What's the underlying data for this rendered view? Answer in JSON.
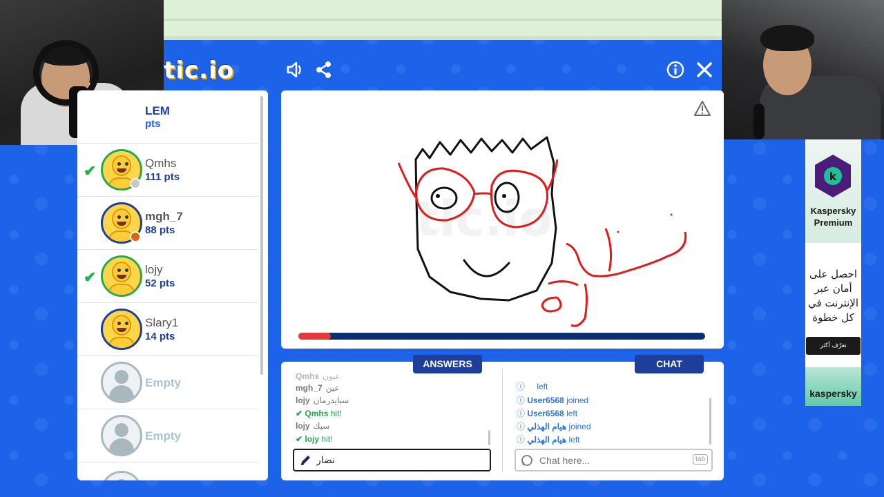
{
  "app": {
    "logo_text": "tic.io",
    "colors": {
      "background": "#1d63ea",
      "panel": "#ffffff",
      "navy": "#1d3f9a",
      "green": "#22b14c",
      "progress_fill": "#e5393b",
      "progress_track": "#0d2d72"
    }
  },
  "header": {
    "icons": [
      "sound-icon",
      "share-icon",
      "info-icon",
      "close-icon"
    ]
  },
  "players": {
    "partial_top": {
      "name": "LEM",
      "pts": "pts"
    },
    "list": [
      {
        "name": "Qmhs",
        "pts": "111 pts",
        "guessed": true,
        "status": "grey"
      },
      {
        "name": "mgh_7",
        "pts": "88 pts",
        "guessed": false,
        "status": "orange"
      },
      {
        "name": "lojy",
        "pts": "52 pts",
        "guessed": true,
        "status": ""
      },
      {
        "name": "Slary1",
        "pts": "14 pts",
        "guessed": false,
        "status": ""
      }
    ],
    "empty_slots": [
      {
        "label": "Empty"
      },
      {
        "label": "Empty"
      }
    ]
  },
  "canvas": {
    "drawn_word": "نظارة",
    "time_progress": 0.08
  },
  "answers": {
    "tab_label": "ANSWERS",
    "messages": [
      {
        "user": "Qmhs",
        "text": "عيون",
        "type": "guess"
      },
      {
        "user": "mgh_7",
        "text": "عين",
        "type": "guess"
      },
      {
        "user": "lojy",
        "text": "سبايدرمان",
        "type": "guess"
      },
      {
        "user": "Qmhs",
        "text": "hit!",
        "type": "hit"
      },
      {
        "user": "lojy",
        "text": "سيك",
        "type": "guess"
      },
      {
        "user": "lojy",
        "text": "hit!",
        "type": "hit"
      }
    ],
    "input_value": "نضار"
  },
  "chat": {
    "tab_label": "CHAT",
    "messages": [
      {
        "user": "",
        "text": "left"
      },
      {
        "user": "User6568",
        "text": "joined"
      },
      {
        "user": "User6568",
        "text": "left"
      },
      {
        "user": "هيام الهذلي",
        "text": "joined"
      },
      {
        "user": "هيام الهذلي",
        "text": "left"
      }
    ],
    "input_placeholder": "Chat here...",
    "tab_key": "tab"
  },
  "ad": {
    "brand_line1": "Kaspersky",
    "brand_line2": "Premium",
    "arabic_text": "احصل على أمان عبر الإنترنت في كل خطوة",
    "cta": "تعرّف أكثر",
    "footer": "kaspersky"
  }
}
